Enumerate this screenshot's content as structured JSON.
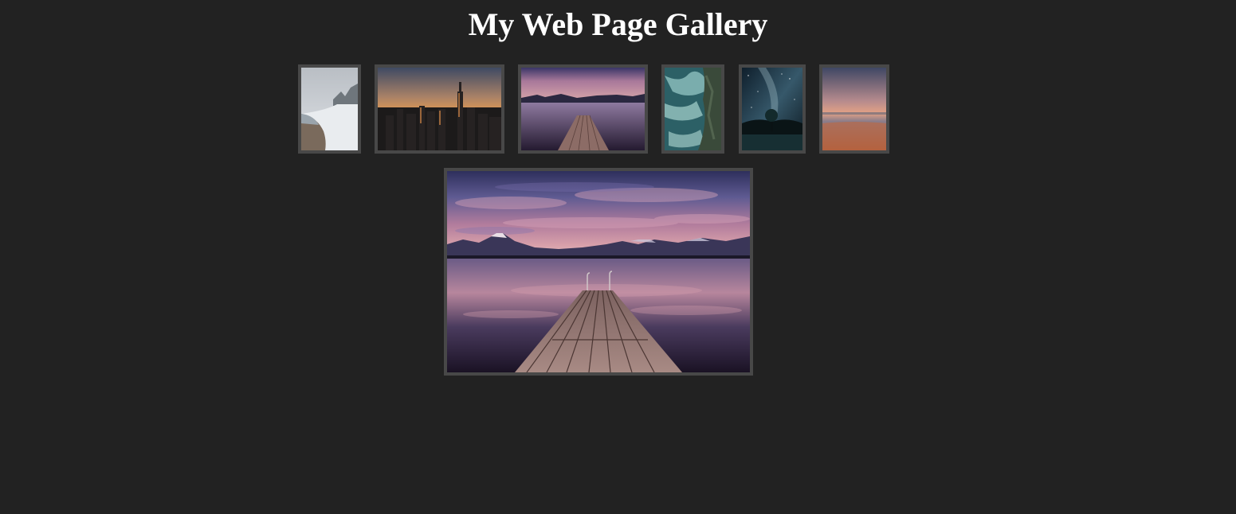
{
  "page": {
    "title": "My Web Page Gallery",
    "background": "#222222",
    "frame_color": "#484848"
  },
  "thumbnails": [
    {
      "subject": "snowy-beach"
    },
    {
      "subject": "city-skyline-sunset"
    },
    {
      "subject": "lake-pier-dusk",
      "selected": true
    },
    {
      "subject": "ocean-waves-cliff"
    },
    {
      "subject": "milky-way-tree"
    },
    {
      "subject": "beach-sunset"
    }
  ],
  "main_image": {
    "subject": "lake-pier-dusk"
  }
}
